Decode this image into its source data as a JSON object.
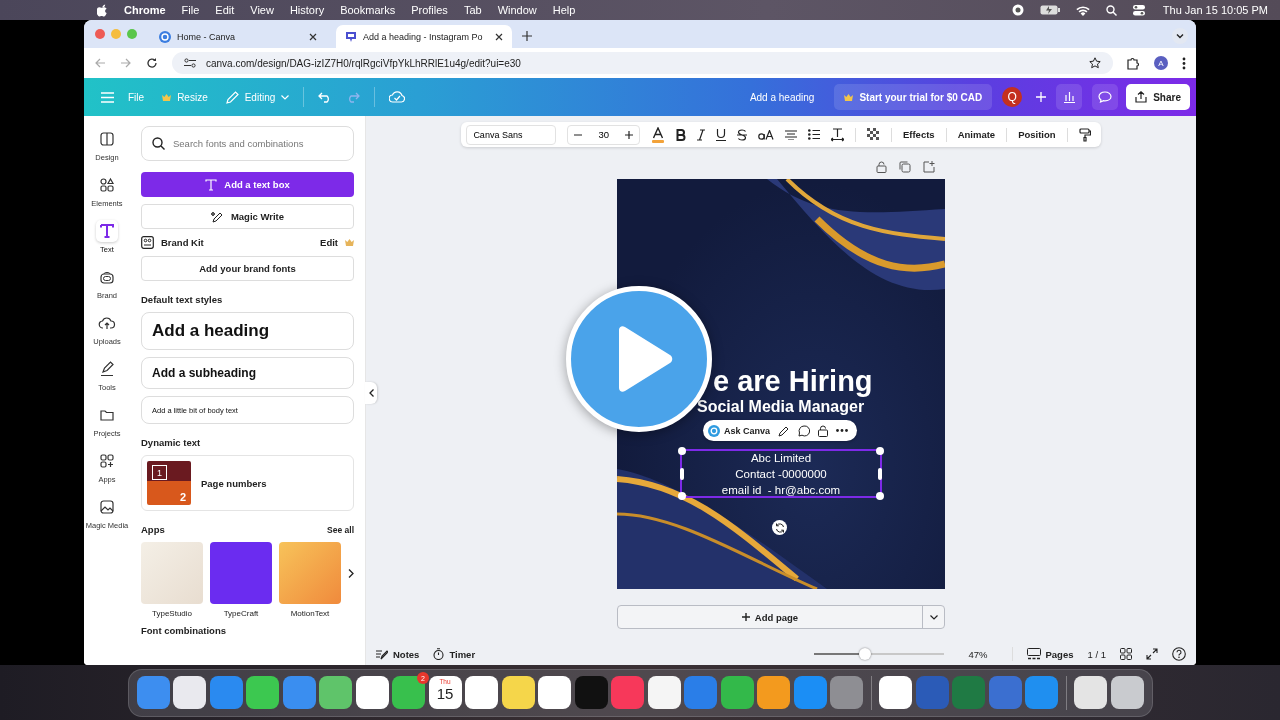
{
  "menubar": {
    "app": "Chrome",
    "menus": [
      "File",
      "Edit",
      "View",
      "History",
      "Bookmarks",
      "Profiles",
      "Tab",
      "Window",
      "Help"
    ],
    "clock": "Thu Jan 15  10:05 PM"
  },
  "browser": {
    "tabs": [
      {
        "title": "Home - Canva",
        "selected": false
      },
      {
        "title": "Add a heading - Instagram Po",
        "selected": true
      }
    ],
    "url": "canva.com/design/DAG-izIZ7H0/rqlRgciVfpYkLhRRlE1u4g/edit?ui=e30",
    "profile": "A"
  },
  "topbar": {
    "file": "File",
    "resize": "Resize",
    "editing": "Editing",
    "title": "Add a heading",
    "trial": "Start your trial for $0 CAD",
    "user": "Q",
    "share": "Share"
  },
  "rail": [
    {
      "label": "Design",
      "selected": false
    },
    {
      "label": "Elements",
      "selected": false
    },
    {
      "label": "Text",
      "selected": true
    },
    {
      "label": "Brand",
      "selected": false
    },
    {
      "label": "Uploads",
      "selected": false
    },
    {
      "label": "Tools",
      "selected": false
    },
    {
      "label": "Projects",
      "selected": false
    },
    {
      "label": "Apps",
      "selected": false
    },
    {
      "label": "Magic Media",
      "selected": false
    }
  ],
  "panel": {
    "search": {
      "placeholder": "Search fonts and combinations"
    },
    "add_text_box": "Add a text box",
    "magic_write": "Magic Write",
    "brand_kit": {
      "title": "Brand Kit",
      "edit": "Edit",
      "add_fonts": "Add your brand fonts"
    },
    "default_styles": {
      "title": "Default text styles",
      "heading": "Add a heading",
      "subheading": "Add a subheading",
      "body": "Add a little bit of body text"
    },
    "dynamic": {
      "title": "Dynamic text",
      "thumb": [
        "1",
        "2"
      ],
      "item": "Page numbers"
    },
    "apps": {
      "title": "Apps",
      "see_all": "See all",
      "items": [
        "TypeStudio",
        "TypeCraft",
        "MotionText"
      ]
    },
    "next_section": "Font combinations"
  },
  "toolbar": {
    "font": "Canva Sans",
    "size": "30",
    "buttons": [
      "Effects",
      "Animate",
      "Position"
    ]
  },
  "design": {
    "heading": "e are Hiring",
    "subheading": "Social Media Manager",
    "ask": "Ask Canva",
    "lines": [
      "Abc Limited",
      "Contact -0000000",
      "email id  - hr@abc.com"
    ]
  },
  "add_page": "Add page",
  "footer": {
    "notes": "Notes",
    "timer": "Timer",
    "zoom": {
      "level": 0.4
    },
    "zoom_reading": "47%",
    "pages": "Pages",
    "page_count": "1 / 1"
  },
  "dock": {
    "calendar": {
      "day": "Thu",
      "date": "15"
    },
    "badge": "2"
  }
}
